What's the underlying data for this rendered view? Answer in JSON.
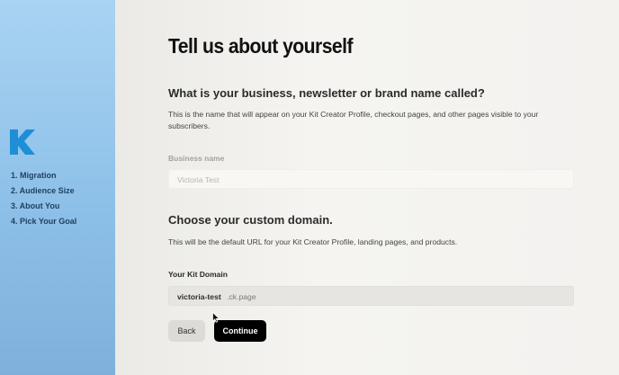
{
  "sidebar": {
    "logo_icon": "kit-logo-icon",
    "steps": [
      "1. Migration",
      "2. Audience Size",
      "3. About You",
      "4. Pick Your Goal"
    ]
  },
  "main": {
    "title": "Tell us about yourself",
    "business_section": {
      "heading": "What is your business, newsletter or brand name called?",
      "description": "This is the name that will appear on your Kit Creator Profile, checkout pages, and other pages visible to your subscribers.",
      "field_label": "Business name",
      "field_placeholder": "Victoria Test"
    },
    "domain_section": {
      "heading": "Choose your custom domain.",
      "description": "This will be the default URL for your Kit Creator Profile, landing pages, and products.",
      "field_label": "Your Kit Domain",
      "field_value": "victoria-test",
      "field_suffix": ".ck.page"
    },
    "buttons": {
      "back": "Back",
      "continue": "Continue"
    }
  },
  "colors": {
    "sidebar_top": "#a9d3f2",
    "sidebar_bottom": "#7fb0dc",
    "logo": "#1e8fd6",
    "continue_button": "#000000"
  }
}
